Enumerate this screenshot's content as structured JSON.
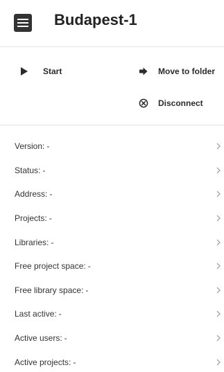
{
  "header": {
    "title": "Budapest-1",
    "icon": "menu-icon"
  },
  "actions": {
    "start": {
      "label": "Start",
      "icon": "play-icon"
    },
    "move_to_folder": {
      "label": "Move to folder",
      "icon": "arrow-right-icon"
    },
    "disconnect": {
      "label": "Disconnect",
      "icon": "disconnect-icon"
    }
  },
  "info": [
    {
      "label": "Version:",
      "value": "-"
    },
    {
      "label": "Status:",
      "value": "-"
    },
    {
      "label": "Address:",
      "value": "-"
    },
    {
      "label": "Projects:",
      "value": "-"
    },
    {
      "label": "Libraries:",
      "value": "-"
    },
    {
      "label": "Free project space:",
      "value": "-"
    },
    {
      "label": "Free library space:",
      "value": "-"
    },
    {
      "label": "Last active:",
      "value": "-"
    },
    {
      "label": "Active users:",
      "value": "-"
    },
    {
      "label": "Active projects:",
      "value": "-"
    }
  ],
  "colors": {
    "text": "#2b2b2b",
    "icon_dark": "#333333",
    "divider": "#e2e2e2",
    "chevron": "#9a9a9a"
  }
}
